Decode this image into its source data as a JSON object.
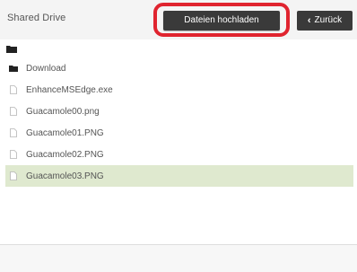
{
  "header": {
    "title": "Shared Drive",
    "upload_label": "Dateien hochladen",
    "back_label": "Zurück",
    "highlight_color": "#e0242f"
  },
  "toolbar_icons": [
    "folder-up-icon"
  ],
  "files": [
    {
      "name": "Download",
      "type": "folder",
      "icon": "folder-icon",
      "selected": false
    },
    {
      "name": "EnhanceMSEdge.exe",
      "type": "file",
      "icon": "file-icon",
      "selected": false
    },
    {
      "name": "Guacamole00.png",
      "type": "file",
      "icon": "file-icon",
      "selected": false
    },
    {
      "name": "Guacamole01.PNG",
      "type": "file",
      "icon": "file-icon",
      "selected": false
    },
    {
      "name": "Guacamole02.PNG",
      "type": "file",
      "icon": "file-icon",
      "selected": false
    },
    {
      "name": "Guacamole03.PNG",
      "type": "file",
      "icon": "file-icon",
      "selected": true
    }
  ],
  "colors": {
    "button_bg": "#3a3a3a",
    "selected_row": "#dfe9cf",
    "header_bg": "#f4f4f4"
  }
}
